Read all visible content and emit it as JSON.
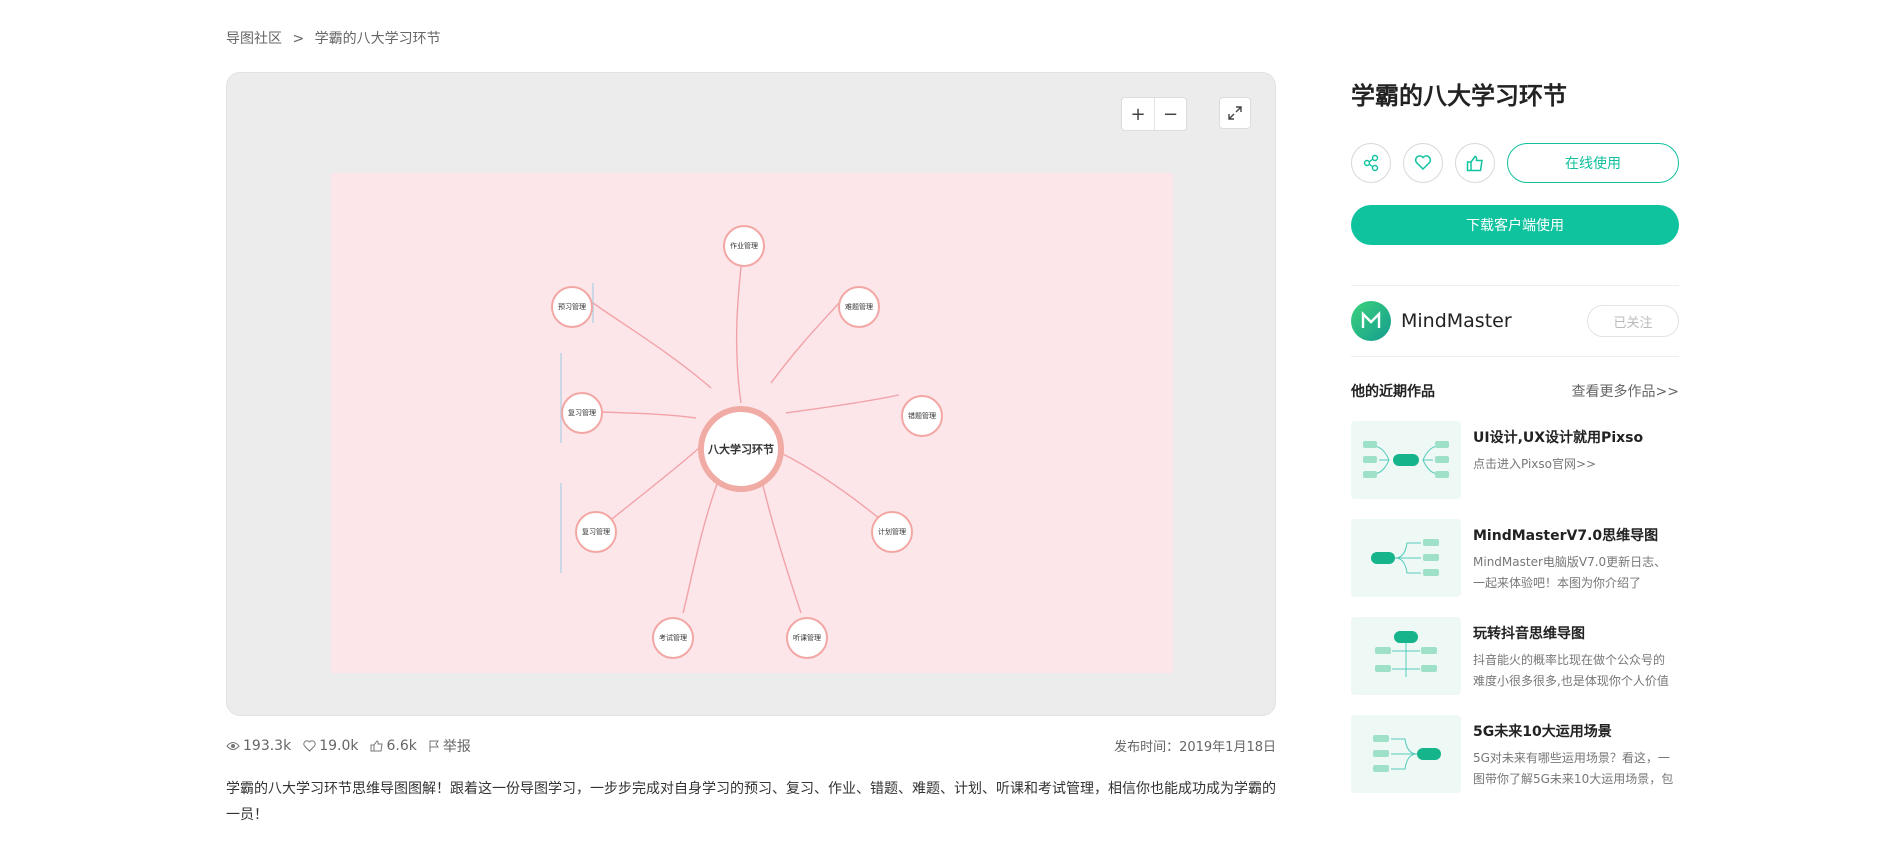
{
  "breadcrumb": {
    "root": "导图社区",
    "sep": ">",
    "current": "学霸的八大学习环节"
  },
  "viewer": {
    "zoom_in": "+",
    "zoom_out": "−"
  },
  "mindmap": {
    "center": "八大学习环节",
    "nodes": [
      {
        "label": "作业管理"
      },
      {
        "label": "预习管理"
      },
      {
        "label": "难题管理"
      },
      {
        "label": "复习管理"
      },
      {
        "label": "错题管理"
      },
      {
        "label": "复习管理"
      },
      {
        "label": "计划管理"
      },
      {
        "label": "考试管理"
      },
      {
        "label": "听课管理"
      }
    ]
  },
  "stats": {
    "views": "193.3k",
    "likes": "19.0k",
    "thumbs": "6.6k",
    "report": "举报"
  },
  "publish": "发布时间：2019年1月18日",
  "description": "学霸的八大学习环节思维导图图解！跟着这一份导图学习，一步步完成对自身学习的预习、复习、作业、错题、难题、计划、听课和考试管理，相信你也能成功成为学霸的一员！",
  "side": {
    "title": "学霸的八大学习环节",
    "online_btn": "在线使用",
    "download_btn": "下载客户端使用",
    "author": "MindMaster",
    "follow_btn": "已关注",
    "works_title": "他的近期作品",
    "works_more": "查看更多作品>>",
    "works": [
      {
        "title": "UI设计,UX设计就用Pixso",
        "line1": "点击进入Pixso官网>>",
        "line2": ""
      },
      {
        "title": "MindMasterV7.0思维导图",
        "line1": "MindMaster电脑版V7.0更新日志、",
        "line2": "一起来体验吧！本图为你介绍了"
      },
      {
        "title": "玩转抖音思维导图",
        "line1": "抖音能火的概率比现在做个公众号的",
        "line2": "难度小很多很多,也是体现你个人价值"
      },
      {
        "title": "5G未来10大运用场景",
        "line1": "5G对未来有哪些运用场景？看这，一",
        "line2": "图带你了解5G未来10大运用场景，包"
      }
    ]
  },
  "colors": {
    "accent": "#10c39f",
    "node_border": "#f3a7a4",
    "canvas_bg": "#fce6ea"
  }
}
